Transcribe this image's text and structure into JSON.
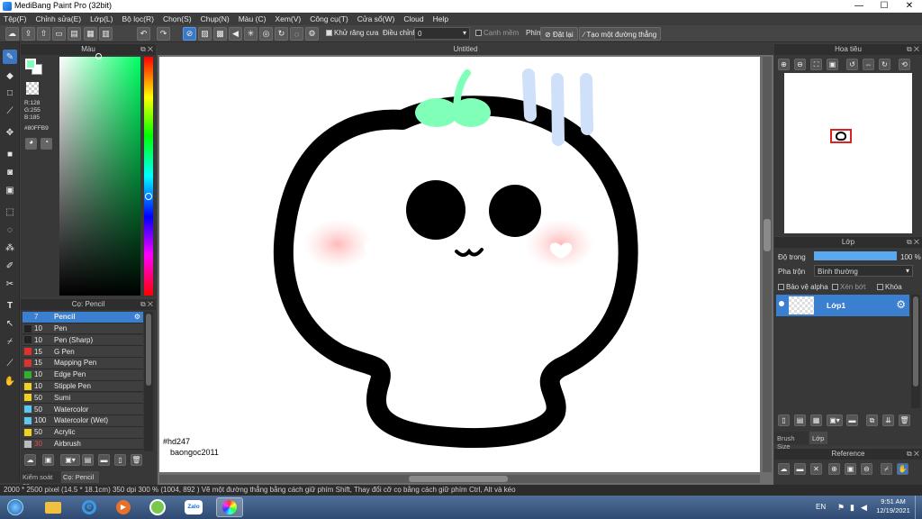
{
  "window": {
    "title": "MediBang Paint Pro (32bit)",
    "min": "—",
    "max": "☐",
    "close": "✕"
  },
  "menu": [
    "Tệp(F)",
    "Chỉnh sửa(E)",
    "Lớp(L)",
    "Bộ lọc(R)",
    "Chọn(S)",
    "Chụp(N)",
    "Màu (C)",
    "Xem(V)",
    "Công cụ(T)",
    "Cửa sổ(W)",
    "Cloud",
    "Help"
  ],
  "toolbar": {
    "antialias_label": "Khử răng cưa",
    "correction_label": "Điều chỉnh",
    "correction_value": "0",
    "edge_label": "Cạnh mềm",
    "key_label": "Phím",
    "reset_label": "Đặt lại",
    "straight_line_label": "Tạo một đường thẳng"
  },
  "color_panel": {
    "title": "Màu",
    "r": "R:128",
    "g": "G:255",
    "b": "B:185",
    "hex": "#80FFB9",
    "fg_color": "#80FFB9",
    "bg_color": "#FFFFFF"
  },
  "brush_panel": {
    "title": "Cọ: Pencil",
    "brushes": [
      {
        "size": "7",
        "name": "Pencil",
        "color": "#3a7fd0"
      },
      {
        "size": "10",
        "name": "Pen",
        "color": "#222222"
      },
      {
        "size": "10",
        "name": "Pen (Sharp)",
        "color": "#222222"
      },
      {
        "size": "15",
        "name": "G Pen",
        "color": "#e03030"
      },
      {
        "size": "15",
        "name": "Mapping Pen",
        "color": "#e03030"
      },
      {
        "size": "10",
        "name": "Edge Pen",
        "color": "#30b030"
      },
      {
        "size": "10",
        "name": "Stipple Pen",
        "color": "#f0d020"
      },
      {
        "size": "50",
        "name": "Sumi",
        "color": "#f0d020"
      },
      {
        "size": "50",
        "name": "Watercolor",
        "color": "#5ac8f0"
      },
      {
        "size": "100",
        "name": "Watercolor (Wet)",
        "color": "#5ac8f0"
      },
      {
        "size": "50",
        "name": "Acrylic",
        "color": "#f0d020"
      },
      {
        "size": "30",
        "name": "Airbrush",
        "color": "#bbbbbb"
      }
    ],
    "tab1": "Kiểm soát cọ",
    "tab2": "Cọ: Pencil"
  },
  "canvas": {
    "title": "Untitled",
    "watermark_line1": "#hd247",
    "watermark_line2": "baongoc2011"
  },
  "navigator": {
    "title": "Hoa tiêu"
  },
  "layer_panel": {
    "title": "Lớp",
    "opacity_label": "Độ trong",
    "opacity_value": "100 %",
    "opacity_fraction": 1.0,
    "blend_label": "Pha trộn",
    "blend_value": "Bình thường",
    "protect_alpha": "Bảo vệ alpha",
    "clipping": "Xén bớt",
    "lock": "Khóa",
    "layer_name": "Lớp1",
    "tab_brush_size": "Brush Size",
    "tab_layer": "Lớp"
  },
  "reference": {
    "title": "Reference"
  },
  "status": {
    "text": "2000 * 2500 pixel  (14.5 * 18.1cm)  350 dpi  300 %  (1004, 892 )  Vẽ một đường thẳng bằng cách giữ phím Shift, Thay đổi cỡ cọ bằng cách giữ phím Ctrl, Alt và kéo"
  },
  "taskbar": {
    "lang": "EN",
    "time": "9:51 AM",
    "date": "12/19/2021",
    "zalo": "Zalo"
  }
}
